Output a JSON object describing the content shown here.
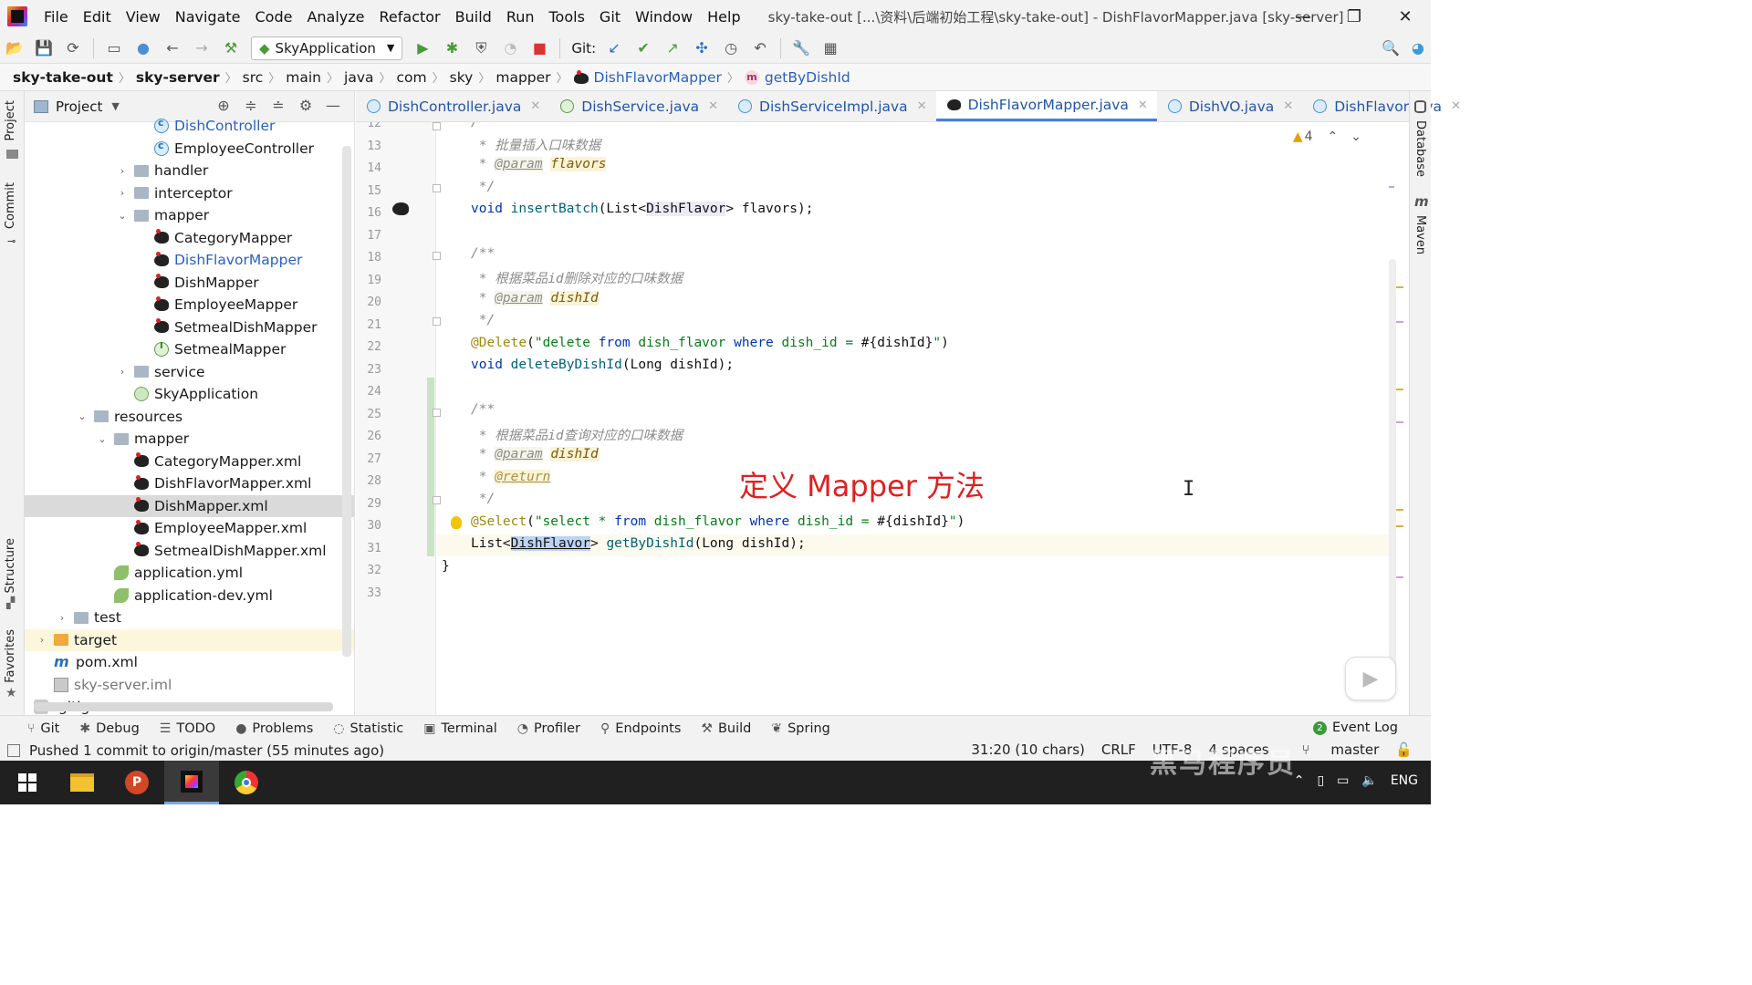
{
  "window": {
    "title": "sky-take-out [...\\资料\\后端初始工程\\sky-take-out] - DishFlavorMapper.java [sky-server]",
    "menu": [
      "File",
      "Edit",
      "View",
      "Navigate",
      "Code",
      "Analyze",
      "Refactor",
      "Build",
      "Run",
      "Tools",
      "Git",
      "Window",
      "Help"
    ]
  },
  "toolbar": {
    "run_config": "SkyApplication",
    "git_label": "Git:"
  },
  "breadcrumb": [
    "sky-take-out",
    "sky-server",
    "src",
    "main",
    "java",
    "com",
    "sky",
    "mapper",
    "DishFlavorMapper",
    "getByDishId"
  ],
  "project_panel": {
    "title": "Project",
    "tree": [
      {
        "label": "DishController",
        "icon": "class-icon",
        "level": 4,
        "arrow": "",
        "color": "blue"
      },
      {
        "label": "EmployeeController",
        "icon": "class-icon",
        "level": 4,
        "arrow": ""
      },
      {
        "label": "handler",
        "icon": "folder-icon",
        "level": 3,
        "arrow": "›"
      },
      {
        "label": "interceptor",
        "icon": "folder-icon",
        "level": 3,
        "arrow": "›"
      },
      {
        "label": "mapper",
        "icon": "folder-icon",
        "level": 3,
        "arrow": "⌄"
      },
      {
        "label": "CategoryMapper",
        "icon": "mybatis-icon",
        "level": 4,
        "arrow": ""
      },
      {
        "label": "DishFlavorMapper",
        "icon": "mybatis-icon",
        "level": 4,
        "arrow": "",
        "color": "blue"
      },
      {
        "label": "DishMapper",
        "icon": "mybatis-icon",
        "level": 4,
        "arrow": ""
      },
      {
        "label": "EmployeeMapper",
        "icon": "mybatis-icon",
        "level": 4,
        "arrow": ""
      },
      {
        "label": "SetmealDishMapper",
        "icon": "mybatis-icon",
        "level": 4,
        "arrow": ""
      },
      {
        "label": "SetmealMapper",
        "icon": "interface-icon",
        "level": 4,
        "arrow": ""
      },
      {
        "label": "service",
        "icon": "folder-icon",
        "level": 3,
        "arrow": "›"
      },
      {
        "label": "SkyApplication",
        "icon": "spring-class-icon",
        "level": 3,
        "arrow": ""
      },
      {
        "label": "resources",
        "icon": "folder-icon",
        "level": 1,
        "arrow": "⌄"
      },
      {
        "label": "mapper",
        "icon": "folder-icon",
        "level": 2,
        "arrow": "⌄"
      },
      {
        "label": "CategoryMapper.xml",
        "icon": "mybatis-icon",
        "level": 3,
        "arrow": ""
      },
      {
        "label": "DishFlavorMapper.xml",
        "icon": "mybatis-icon",
        "level": 3,
        "arrow": ""
      },
      {
        "label": "DishMapper.xml",
        "icon": "mybatis-icon",
        "level": 3,
        "arrow": "",
        "selected": true
      },
      {
        "label": "EmployeeMapper.xml",
        "icon": "mybatis-icon",
        "level": 3,
        "arrow": ""
      },
      {
        "label": "SetmealDishMapper.xml",
        "icon": "mybatis-icon",
        "level": 3,
        "arrow": ""
      },
      {
        "label": "application.yml",
        "icon": "yaml-icon",
        "level": 2,
        "arrow": ""
      },
      {
        "label": "application-dev.yml",
        "icon": "yaml-icon",
        "level": 2,
        "arrow": ""
      },
      {
        "label": "test",
        "icon": "folder-icon",
        "level": 0,
        "arrow": "›"
      },
      {
        "label": "target",
        "icon": "folder-orange-icon",
        "level": -1,
        "arrow": "›",
        "target": true
      },
      {
        "label": "pom.xml",
        "icon": "maven-icon",
        "level": -1,
        "arrow": ""
      },
      {
        "label": "sky-server.iml",
        "icon": "iml-icon",
        "level": -1,
        "arrow": "",
        "color": "gray"
      },
      {
        "label": ".gitignore",
        "icon": "git-icon",
        "level": -2,
        "arrow": ""
      }
    ]
  },
  "left_tabs": [
    "Project",
    "Commit",
    "Structure",
    "Favorites"
  ],
  "right_tabs": [
    "Database",
    "Maven"
  ],
  "tabs": [
    {
      "label": "DishController.java",
      "icon": "c"
    },
    {
      "label": "DishService.java",
      "icon": "i"
    },
    {
      "label": "DishServiceImpl.java",
      "icon": "c"
    },
    {
      "label": "DishFlavorMapper.java",
      "icon": "m",
      "active": true
    },
    {
      "label": "DishVO.java",
      "icon": "c"
    },
    {
      "label": "DishFlavor.java",
      "icon": "c"
    }
  ],
  "editor": {
    "warning_count": "4",
    "line_numbers": [
      "12",
      "13",
      "14",
      "15",
      "16",
      "17",
      "18",
      "19",
      "20",
      "21",
      "22",
      "23",
      "24",
      "25",
      "26",
      "27",
      "28",
      "29",
      "30",
      "31",
      "32",
      "33"
    ],
    "lines": {
      "l12": "/",
      "l13": " * 批量插入口味数据",
      "l14a": " * ",
      "l14b": "@param",
      "l14c": "flavors",
      "l15": " */",
      "l16a": "void ",
      "l16b": "insertBatch",
      "l16c": "(List<",
      "l16d": "DishFlavor",
      "l16e": "> flavors);",
      "l18": "/**",
      "l19": " * 根据菜品id删除对应的口味数据",
      "l20a": " * ",
      "l20b": "@param",
      "l20c": "dishId",
      "l21": " */",
      "l22a": "@Delete",
      "l22b": "(",
      "l22c": "\"delete ",
      "l22d": "from",
      "l22e": " dish_flavor ",
      "l22f": "where",
      "l22g": " dish_id = ",
      "l22h": "#{dishId}",
      "l22i": "\"",
      "l22j": ")",
      "l23a": "void ",
      "l23b": "deleteByDishId",
      "l23c": "(Long dishId);",
      "l25": "/**",
      "l26": " * 根据菜品id查询对应的口味数据",
      "l27a": " * ",
      "l27b": "@param",
      "l27c": "dishId",
      "l28a": " * ",
      "l28b": "@return",
      "l29": " */",
      "l30a": "@Select",
      "l30b": "(",
      "l30c": "\"select * ",
      "l30d": "from",
      "l30e": " dish_flavor ",
      "l30f": "where",
      "l30g": " dish_id = ",
      "l30h": "#{dishId}",
      "l30i": "\"",
      "l30j": ")",
      "l31a": "List<",
      "l31b": "DishFlavor",
      "l31c": "> ",
      "l31d": "getByDishId",
      "l31e": "(Long dishId);",
      "l32": "}"
    },
    "overlay_caption": "定义 Mapper 方法"
  },
  "bottom_tools": [
    "Git",
    "Debug",
    "TODO",
    "Problems",
    "Statistic",
    "Terminal",
    "Profiler",
    "Endpoints",
    "Build",
    "Spring"
  ],
  "event_log": {
    "count": "2",
    "label": "Event Log"
  },
  "status": {
    "message": "Pushed 1 commit to origin/master (55 minutes ago)",
    "position": "31:20 (10 chars)",
    "line_sep": "CRLF",
    "encoding": "UTF-8",
    "indent": "4 spaces",
    "branch": "master"
  },
  "taskbar": {
    "lang": "ENG"
  },
  "watermark": "黑马程序员"
}
